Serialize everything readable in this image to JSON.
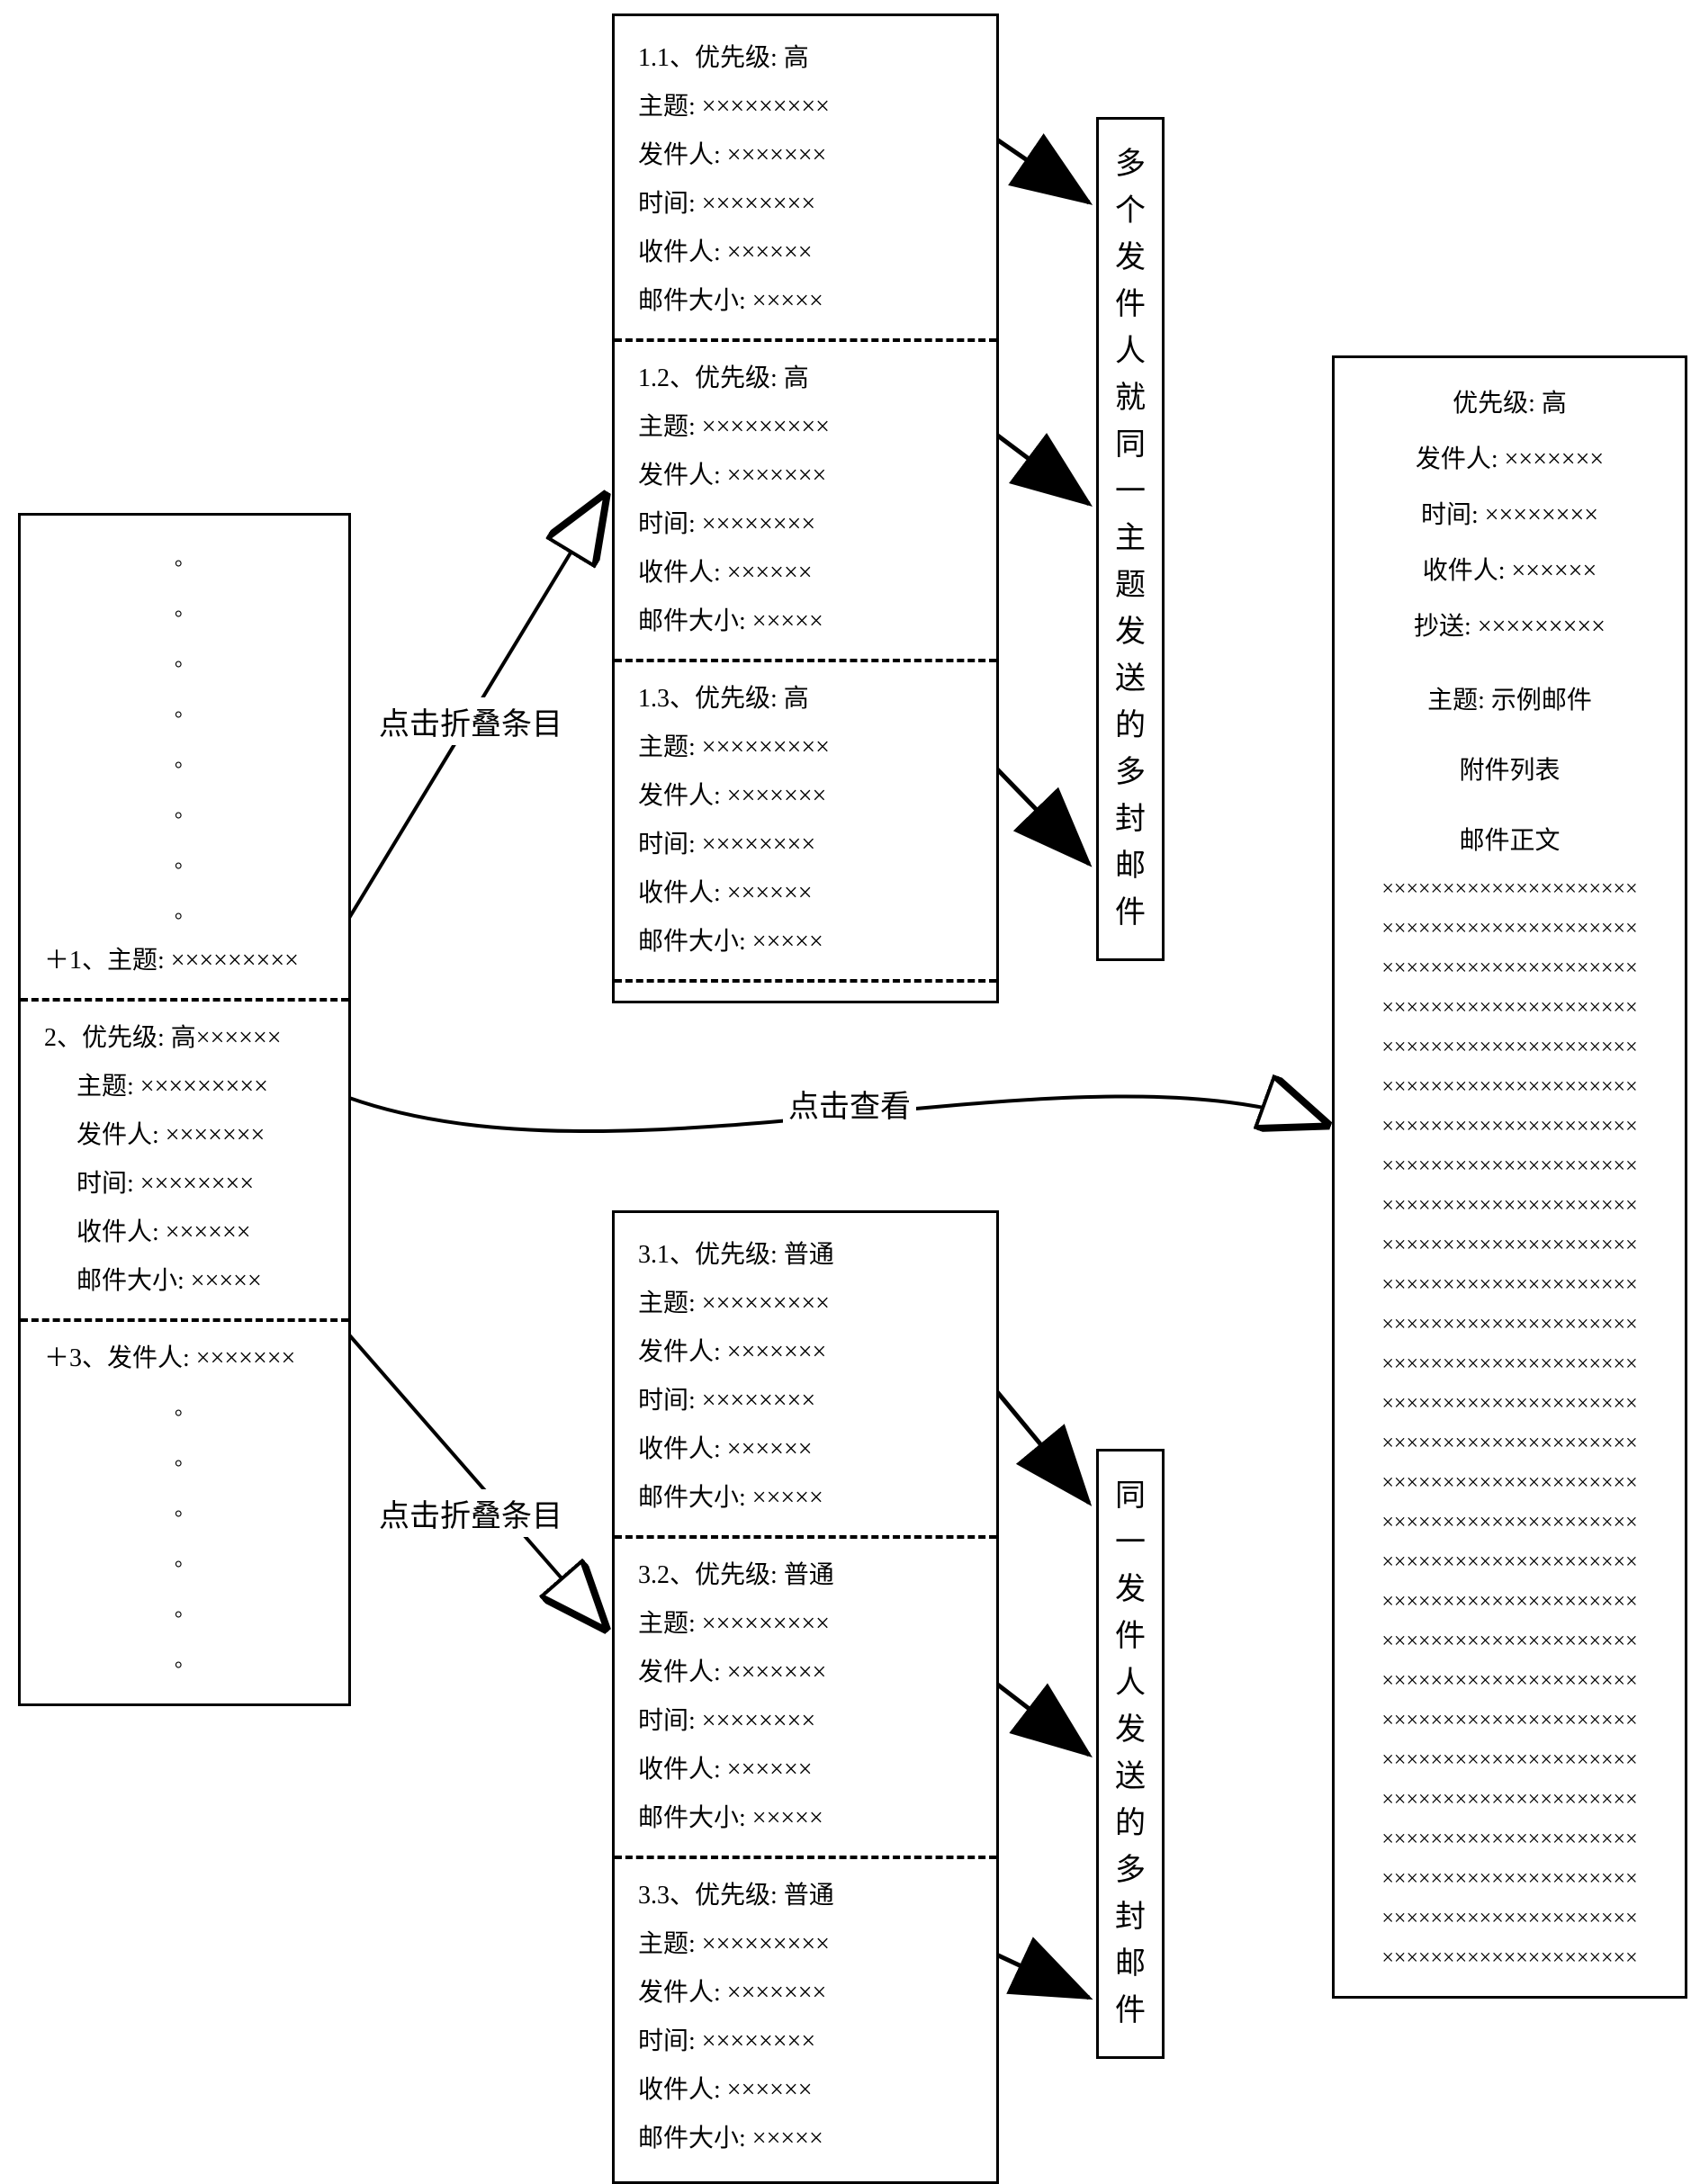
{
  "leftPanel": {
    "dotsTop": [
      "。",
      "。",
      "。",
      "。",
      "。",
      "。",
      "。",
      "。"
    ],
    "item1": {
      "prefix": "＋1、主题: ",
      "val": "×××××××××"
    },
    "item2": {
      "header": "2、优先级: 高××××××",
      "subject_l": "主题: ",
      "subject_v": "×××××××××",
      "sender_l": "发件人: ",
      "sender_v": "×××××××",
      "time_l": "时间: ",
      "time_v": "××××××××",
      "recip_l": "收件人: ",
      "recip_v": "××××××",
      "size_l": "邮件大小: ",
      "size_v": "×××××"
    },
    "item3": {
      "prefix": "＋3、发件人: ",
      "val": "×××××××"
    },
    "dotsBottom": [
      "。",
      "。",
      "。",
      "。",
      "。",
      "。"
    ]
  },
  "labels": {
    "expandTop": "点击折叠条目",
    "expandBottom": "点击折叠条目",
    "view": "点击查看"
  },
  "topExpanded": {
    "e1": {
      "hdr": "1.1、优先级: 高",
      "subject_l": "主题: ",
      "subject_v": "×××××××××",
      "sender_l": "发件人: ",
      "sender_v": "×××××××",
      "time_l": "时间: ",
      "time_v": "××××××××",
      "recip_l": "收件人: ",
      "recip_v": "××××××",
      "size_l": "邮件大小: ",
      "size_v": "×××××"
    },
    "e2": {
      "hdr": "1.2、优先级: 高",
      "subject_l": "主题: ",
      "subject_v": "×××××××××",
      "sender_l": "发件人: ",
      "sender_v": "×××××××",
      "time_l": "时间: ",
      "time_v": "××××××××",
      "recip_l": "收件人: ",
      "recip_v": "××××××",
      "size_l": "邮件大小: ",
      "size_v": "×××××"
    },
    "e3": {
      "hdr": "1.3、优先级: 高",
      "subject_l": "主题: ",
      "subject_v": "×××××××××",
      "sender_l": "发件人: ",
      "sender_v": "×××××××",
      "time_l": "时间: ",
      "time_v": "××××××××",
      "recip_l": "收件人: ",
      "recip_v": "××××××",
      "size_l": "邮件大小: ",
      "size_v": "×××××"
    }
  },
  "bottomExpanded": {
    "e1": {
      "hdr": "3.1、优先级: 普通",
      "subject_l": "主题: ",
      "subject_v": "×××××××××",
      "sender_l": "发件人: ",
      "sender_v": "×××××××",
      "time_l": "时间: ",
      "time_v": "××××××××",
      "recip_l": "收件人: ",
      "recip_v": "××××××",
      "size_l": "邮件大小: ",
      "size_v": "×××××"
    },
    "e2": {
      "hdr": "3.2、优先级: 普通",
      "subject_l": "主题: ",
      "subject_v": "×××××××××",
      "sender_l": "发件人: ",
      "sender_v": "×××××××",
      "time_l": "时间: ",
      "time_v": "××××××××",
      "recip_l": "收件人: ",
      "recip_v": "××××××",
      "size_l": "邮件大小: ",
      "size_v": "×××××"
    },
    "e3": {
      "hdr": "3.3、优先级: 普通",
      "subject_l": "主题: ",
      "subject_v": "×××××××××",
      "sender_l": "发件人: ",
      "sender_v": "×××××××",
      "time_l": "时间: ",
      "time_v": "××××××××",
      "recip_l": "收件人: ",
      "recip_v": "××××××",
      "size_l": "邮件大小: ",
      "size_v": "×××××"
    }
  },
  "vnoteTop": [
    "多",
    "个",
    "发",
    "件",
    "人",
    "就",
    "同",
    "一",
    "主",
    "题",
    "发",
    "送",
    "的",
    "多",
    "封",
    "邮",
    "件"
  ],
  "vnoteBottom": [
    "同",
    "一",
    "发",
    "件",
    "人",
    "发",
    "送",
    "的",
    "多",
    "封",
    "邮",
    "件"
  ],
  "detail": {
    "prio_l": "优先级: ",
    "prio_v": "高",
    "sender_l": "发件人: ",
    "sender_v": "×××××××",
    "time_l": "时间: ",
    "time_v": "××××××××",
    "recip_l": "收件人: ",
    "recip_v": "××××××",
    "cc_l": "抄送: ",
    "cc_v": "×××××××××",
    "subject_l": "主题: ",
    "subject_v": "示例邮件",
    "attach": "附件列表",
    "body_label": "邮件正文",
    "body_line": "×××××××××××××××××××××",
    "body_count": 28
  }
}
